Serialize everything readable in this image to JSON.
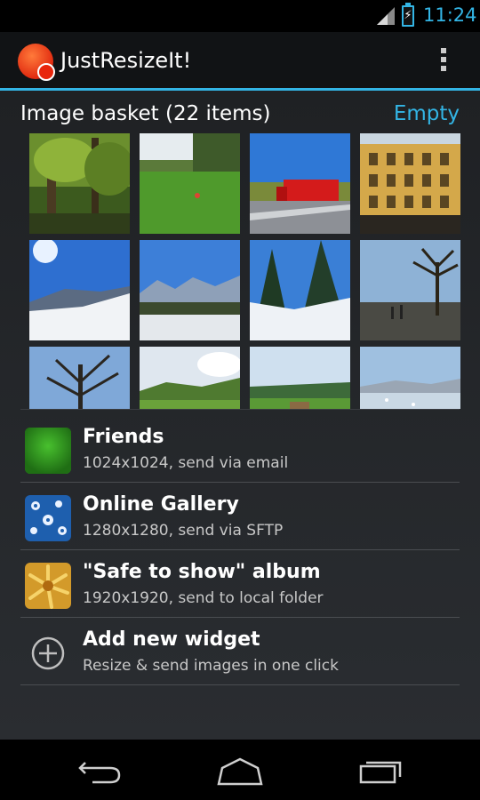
{
  "status_bar": {
    "time": "11:24",
    "signal_icon": "signal-icon",
    "battery_icon": "battery-charging-icon",
    "accent": "#33b5e5"
  },
  "action_bar": {
    "title": "JustResizeIt!",
    "app_icon": "app-logo-icon",
    "overflow_icon": "overflow-menu-icon"
  },
  "basket": {
    "title": "Image basket (22 items)",
    "empty_label": "Empty",
    "thumbnails": [
      "thumb-forest",
      "thumb-green-field",
      "thumb-red-truck",
      "thumb-yellow-building",
      "thumb-snowy-mountain",
      "thumb-snowy-valley",
      "thumb-snow-trees",
      "thumb-lakeside-tree",
      "thumb-bare-tree",
      "thumb-green-hills",
      "thumb-cow-meadow",
      "thumb-lake-swans"
    ]
  },
  "widgets": [
    {
      "title": "Friends",
      "subtitle": "1024x1024, send via email",
      "icon": "green-grass-icon"
    },
    {
      "title": "Online Gallery",
      "subtitle": "1280x1280, send via SFTP",
      "icon": "blue-flowers-icon"
    },
    {
      "title": "\"Safe to show\" album",
      "subtitle": "1920x1920, send to local folder",
      "icon": "yellow-flower-icon"
    },
    {
      "title": "Add new widget",
      "subtitle": "Resize & send images in one click",
      "icon": "add-circle-icon"
    }
  ],
  "nav_bar": {
    "back_icon": "back-icon",
    "home_icon": "home-icon",
    "recents_icon": "recent-apps-icon"
  }
}
